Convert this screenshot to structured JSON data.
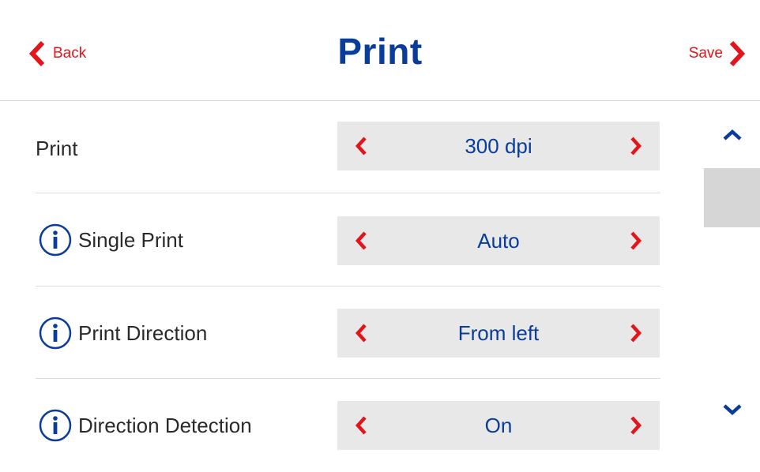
{
  "header": {
    "back_label": "Back",
    "title": "Print",
    "save_label": "Save"
  },
  "settings": [
    {
      "label": "Print",
      "value": "300 dpi",
      "has_info": false
    },
    {
      "label": "Single Print",
      "value": "Auto",
      "has_info": true
    },
    {
      "label": "Print Direction",
      "value": "From left",
      "has_info": true
    },
    {
      "label": "Direction Detection",
      "value": "On",
      "has_info": true
    }
  ],
  "icons": {
    "back": "chevron-left-icon",
    "save": "chevron-right-icon",
    "info": "info-icon",
    "decrease": "chevron-left-icon",
    "increase": "chevron-right-icon",
    "scroll_up": "chevron-up-icon",
    "scroll_down": "chevron-down-icon"
  },
  "colors": {
    "accent_red": "#e3141a",
    "brand_blue": "#0a3d99",
    "stepper_bg": "#e8e8e8",
    "scroll_thumb": "#d6d6d6"
  }
}
